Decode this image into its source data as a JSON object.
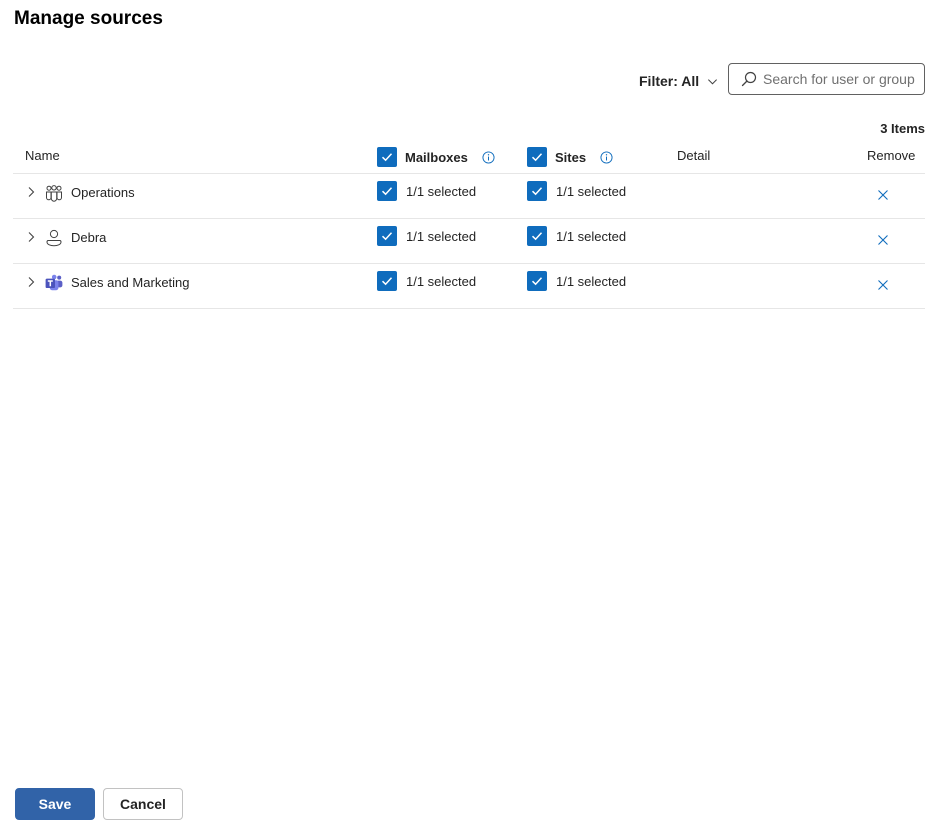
{
  "page": {
    "title": "Manage sources"
  },
  "toolbar": {
    "filter_label": "Filter: All",
    "search_placeholder": "Search for user or group",
    "items_count": "3 Items"
  },
  "table": {
    "columns": {
      "name": "Name",
      "mailboxes": "Mailboxes",
      "sites": "Sites",
      "detail": "Detail",
      "remove": "Remove"
    },
    "rows": [
      {
        "name": "Operations",
        "icon": "group-icon",
        "mailboxes": "1/1 selected",
        "sites": "1/1 selected"
      },
      {
        "name": "Debra",
        "icon": "person-icon",
        "mailboxes": "1/1 selected",
        "sites": "1/1 selected"
      },
      {
        "name": "Sales and Marketing",
        "icon": "teams-icon",
        "mailboxes": "1/1 selected",
        "sites": "1/1 selected"
      }
    ]
  },
  "footer": {
    "save_label": "Save",
    "cancel_label": "Cancel"
  },
  "colors": {
    "accent": "#0f6cbd",
    "primary_button": "#3163a8",
    "teams": "#5b5fc7"
  }
}
